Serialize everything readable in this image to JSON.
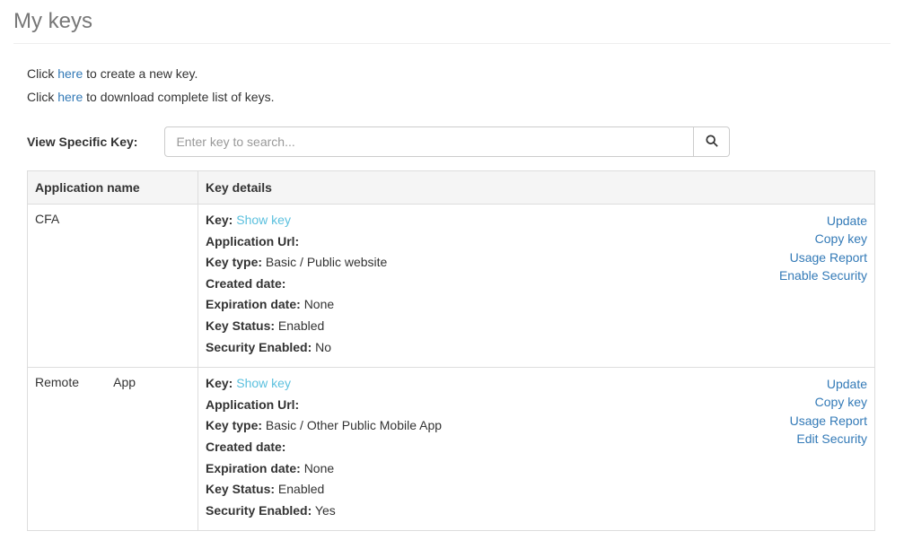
{
  "page": {
    "title": "My keys"
  },
  "intro": {
    "click_prefix": "Click ",
    "here": "here",
    "create_suffix": " to create a new key.",
    "download_suffix": " to download complete list of keys."
  },
  "search": {
    "label": "View Specific Key:",
    "placeholder": "Enter key to search..."
  },
  "table": {
    "col_app": "Application name",
    "col_details": "Key details"
  },
  "rows": [
    {
      "app_name": "CFA",
      "key_label": "Key:",
      "show_key": "Show key",
      "app_url_label": "Application Url:",
      "app_url_value": "",
      "key_type_label": "Key type:",
      "key_type_value": "Basic / Public website",
      "created_label": "Created date:",
      "created_value": "",
      "expiration_label": "Expiration date:",
      "expiration_value": "None",
      "status_label": "Key Status:",
      "status_value": "Enabled",
      "security_label": "Security Enabled:",
      "security_value": "No",
      "actions": {
        "update": "Update",
        "copy": "Copy key",
        "usage": "Usage Report",
        "security": "Enable Security"
      }
    },
    {
      "app_name": "Remote          App",
      "key_label": "Key:",
      "show_key": "Show key",
      "app_url_label": "Application Url:",
      "app_url_value": "",
      "key_type_label": "Key type:",
      "key_type_value": "Basic / Other Public Mobile App",
      "created_label": "Created date:",
      "created_value": "",
      "expiration_label": "Expiration date:",
      "expiration_value": "None",
      "status_label": "Key Status:",
      "status_value": "Enabled",
      "security_label": "Security Enabled:",
      "security_value": "Yes",
      "actions": {
        "update": "Update",
        "copy": "Copy key",
        "usage": "Usage Report",
        "security": "Edit Security"
      }
    }
  ]
}
